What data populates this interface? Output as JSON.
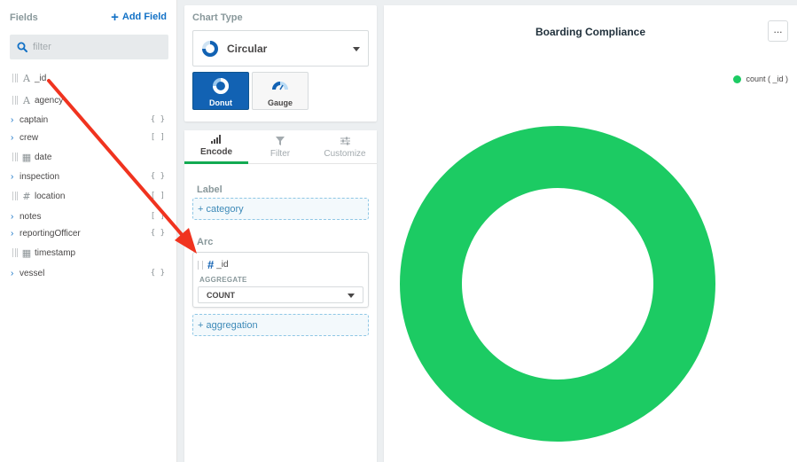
{
  "fields_panel": {
    "title": "Fields",
    "add_field_label": "Add Field",
    "filter_placeholder": "filter",
    "fields": [
      {
        "name": "_id",
        "kind": "string",
        "tag": ""
      },
      {
        "name": "agency",
        "kind": "string",
        "tag": ""
      },
      {
        "name": "captain",
        "kind": "object",
        "tag": "{ }"
      },
      {
        "name": "crew",
        "kind": "array",
        "tag": "[ ]"
      },
      {
        "name": "date",
        "kind": "date",
        "tag": ""
      },
      {
        "name": "inspection",
        "kind": "object",
        "tag": "{ }"
      },
      {
        "name": "location",
        "kind": "number",
        "tag": "[ ]"
      },
      {
        "name": "notes",
        "kind": "array",
        "tag": "[ ]"
      },
      {
        "name": "reportingOfficer",
        "kind": "object",
        "tag": "{ }"
      },
      {
        "name": "timestamp",
        "kind": "date",
        "tag": ""
      },
      {
        "name": "vessel",
        "kind": "object",
        "tag": "{ }"
      }
    ]
  },
  "chart_type": {
    "title": "Chart Type",
    "selected": "Circular",
    "subtypes": [
      {
        "label": "Donut",
        "selected": true
      },
      {
        "label": "Gauge",
        "selected": false
      }
    ]
  },
  "encode": {
    "tabs": [
      {
        "label": "Encode",
        "icon": "bar-signal-icon",
        "active": true
      },
      {
        "label": "Filter",
        "icon": "funnel-icon",
        "active": false
      },
      {
        "label": "Customize",
        "icon": "sliders-icon",
        "active": false
      }
    ],
    "label_section": {
      "title": "Label",
      "dropzone": "+ category"
    },
    "arc_section": {
      "title": "Arc",
      "field_name": "_id",
      "aggregate_label": "AGGREGATE",
      "aggregate_value": "COUNT",
      "dropzone": "+ aggregation"
    }
  },
  "chart": {
    "title": "Boarding Compliance",
    "more_label": "...",
    "legend": "count ( _id )",
    "accent": "#1ccb63"
  },
  "chart_data": {
    "type": "pie",
    "title": "Boarding Compliance",
    "series": [
      {
        "name": "count ( _id )",
        "values": [
          1
        ]
      }
    ],
    "colors": [
      "#1ccb63"
    ],
    "legend_position": "top-right",
    "donut": true
  },
  "colors": {
    "primary_blue": "#1262b3",
    "link_blue": "#1271c6",
    "tab_active": "#13aa52",
    "annotation_arrow": "#f0331f"
  }
}
